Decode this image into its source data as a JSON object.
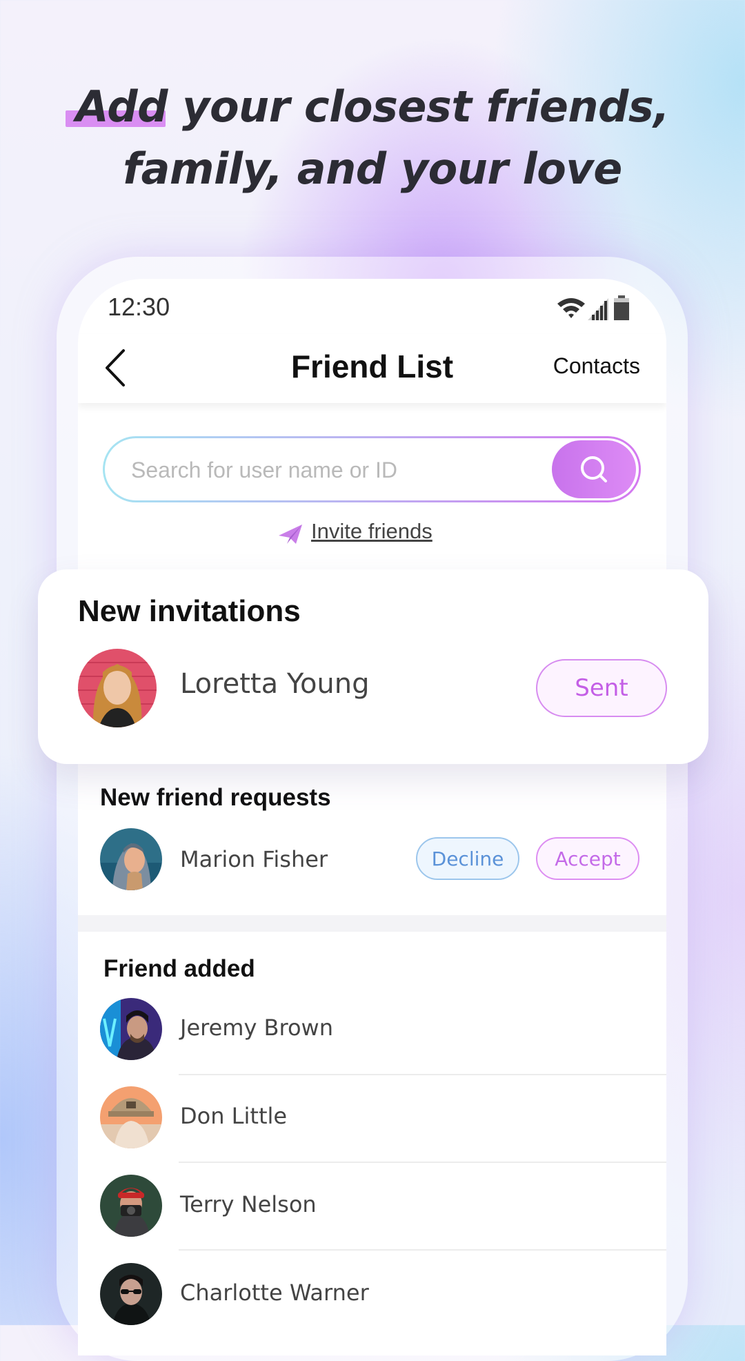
{
  "headline": {
    "line1": "Add your closest friends,",
    "line2": "family, and your love"
  },
  "status_bar": {
    "time": "12:30",
    "icons": [
      "wifi-icon",
      "signal-icon",
      "battery-icon"
    ]
  },
  "nav": {
    "back_icon": "chevron-left-icon",
    "title": "Friend List",
    "contacts_label": "Contacts"
  },
  "search": {
    "placeholder": "Search for user name or ID",
    "value": "",
    "button_icon": "search-icon"
  },
  "invite": {
    "icon": "paper-plane-icon",
    "label": "Invite friends"
  },
  "new_invitations": {
    "title": "New invitations",
    "items": [
      {
        "name": "Loretta Young",
        "status_label": "Sent"
      }
    ]
  },
  "friend_requests": {
    "title": "New friend requests",
    "items": [
      {
        "name": "Marion Fisher",
        "decline_label": "Decline",
        "accept_label": "Accept"
      }
    ]
  },
  "friends_added": {
    "title": "Friend added",
    "items": [
      {
        "name": "Jeremy Brown"
      },
      {
        "name": "Don Little"
      },
      {
        "name": "Terry Nelson"
      },
      {
        "name": "Charlotte Warner"
      }
    ]
  },
  "colors": {
    "accent_purple": "#d478f0",
    "accent_cyan": "#a6e4f2",
    "decline_blue": "#5b92d8",
    "headline_text": "#2c2c34"
  }
}
